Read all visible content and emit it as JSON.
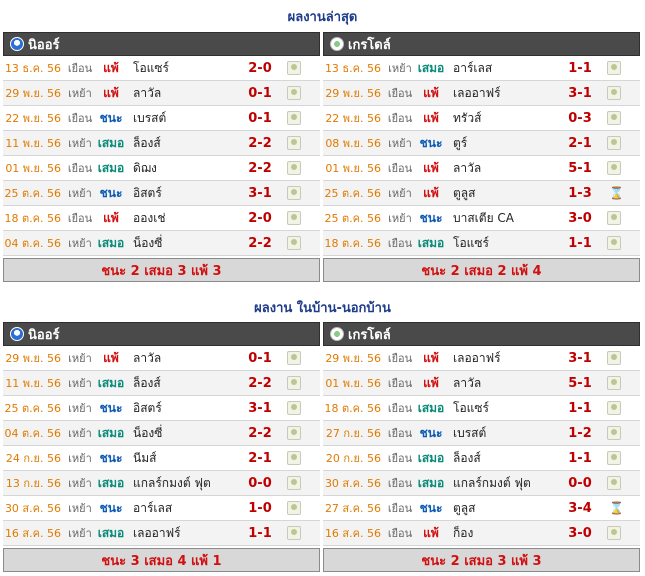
{
  "latest": {
    "title": "ผลงานล่าสุด",
    "left": {
      "team": "นิออร์",
      "rows": [
        {
          "date": "13 ธ.ค. 56",
          "venue": "เยือน",
          "result": "แพ้",
          "opp": "โอแซร์",
          "score": "2-0",
          "icon": "ball"
        },
        {
          "date": "29 พ.ย. 56",
          "venue": "เหย้า",
          "result": "แพ้",
          "opp": "ลาวัล",
          "score": "0-1",
          "icon": "ball"
        },
        {
          "date": "22 พ.ย. 56",
          "venue": "เยือน",
          "result": "ชนะ",
          "opp": "เบรสต์",
          "score": "0-1",
          "icon": "ball"
        },
        {
          "date": "11 พ.ย. 56",
          "venue": "เหย้า",
          "result": "เสมอ",
          "opp": "ล็องส์",
          "score": "2-2",
          "icon": "ball"
        },
        {
          "date": "01 พ.ย. 56",
          "venue": "เยือน",
          "result": "เสมอ",
          "opp": "ดิฌง",
          "score": "2-2",
          "icon": "ball"
        },
        {
          "date": "25 ต.ค. 56",
          "venue": "เหย้า",
          "result": "ชนะ",
          "opp": "อิสตร์",
          "score": "3-1",
          "icon": "ball"
        },
        {
          "date": "18 ต.ค. 56",
          "venue": "เยือน",
          "result": "แพ้",
          "opp": "อองเช่",
          "score": "2-0",
          "icon": "ball"
        },
        {
          "date": "04 ต.ค. 56",
          "venue": "เหย้า",
          "result": "เสมอ",
          "opp": "น็องซี่",
          "score": "2-2",
          "icon": "ball"
        }
      ],
      "summary": "ชนะ 2 เสมอ 3 แพ้ 3"
    },
    "right": {
      "team": "เกรโดล์",
      "rows": [
        {
          "date": "13 ธ.ค. 56",
          "venue": "เหย้า",
          "result": "เสมอ",
          "opp": "อาร์เลส",
          "score": "1-1",
          "icon": "ball"
        },
        {
          "date": "29 พ.ย. 56",
          "venue": "เยือน",
          "result": "แพ้",
          "opp": "เลออาฟร์",
          "score": "3-1",
          "icon": "ball"
        },
        {
          "date": "22 พ.ย. 56",
          "venue": "เยือน",
          "result": "แพ้",
          "opp": "ทรัวส์",
          "score": "0-3",
          "icon": "ball"
        },
        {
          "date": "08 พ.ย. 56",
          "venue": "เหย้า",
          "result": "ชนะ",
          "opp": "ตูร์",
          "score": "2-1",
          "icon": "ball"
        },
        {
          "date": "01 พ.ย. 56",
          "venue": "เยือน",
          "result": "แพ้",
          "opp": "ลาวัล",
          "score": "5-1",
          "icon": "ball"
        },
        {
          "date": "25 ต.ค. 56",
          "venue": "เหย้า",
          "result": "แพ้",
          "opp": "ตูลูส",
          "score": "1-3",
          "icon": "hourglass"
        },
        {
          "date": "25 ต.ค. 56",
          "venue": "เหย้า",
          "result": "ชนะ",
          "opp": "บาสเตีย CA",
          "score": "3-0",
          "icon": "ball"
        },
        {
          "date": "18 ต.ค. 56",
          "venue": "เยือน",
          "result": "เสมอ",
          "opp": "โอแซร์",
          "score": "1-1",
          "icon": "ball"
        }
      ],
      "summary": "ชนะ 2 เสมอ 2 แพ้ 4"
    }
  },
  "homeaway": {
    "title": "ผลงาน ในบ้าน-นอกบ้าน",
    "left": {
      "team": "นิออร์",
      "rows": [
        {
          "date": "29 พ.ย. 56",
          "venue": "เหย้า",
          "result": "แพ้",
          "opp": "ลาวัล",
          "score": "0-1",
          "icon": "ball"
        },
        {
          "date": "11 พ.ย. 56",
          "venue": "เหย้า",
          "result": "เสมอ",
          "opp": "ล็องส์",
          "score": "2-2",
          "icon": "ball"
        },
        {
          "date": "25 ต.ค. 56",
          "venue": "เหย้า",
          "result": "ชนะ",
          "opp": "อิสตร์",
          "score": "3-1",
          "icon": "ball"
        },
        {
          "date": "04 ต.ค. 56",
          "venue": "เหย้า",
          "result": "เสมอ",
          "opp": "น็องซี่",
          "score": "2-2",
          "icon": "ball"
        },
        {
          "date": "24 ก.ย. 56",
          "venue": "เหย้า",
          "result": "ชนะ",
          "opp": "นีมส์",
          "score": "2-1",
          "icon": "ball"
        },
        {
          "date": "13 ก.ย. 56",
          "venue": "เหย้า",
          "result": "เสมอ",
          "opp": "แกลร์กมงต์ ฟุต",
          "score": "0-0",
          "icon": "ball"
        },
        {
          "date": "30 ส.ค. 56",
          "venue": "เหย้า",
          "result": "ชนะ",
          "opp": "อาร์เลส",
          "score": "1-0",
          "icon": "ball"
        },
        {
          "date": "16 ส.ค. 56",
          "venue": "เหย้า",
          "result": "เสมอ",
          "opp": "เลออาฟร์",
          "score": "1-1",
          "icon": "ball"
        }
      ],
      "summary": "ชนะ 3 เสมอ 4 แพ้ 1"
    },
    "right": {
      "team": "เกรโดล์",
      "rows": [
        {
          "date": "29 พ.ย. 56",
          "venue": "เยือน",
          "result": "แพ้",
          "opp": "เลออาฟร์",
          "score": "3-1",
          "icon": "ball"
        },
        {
          "date": "01 พ.ย. 56",
          "venue": "เยือน",
          "result": "แพ้",
          "opp": "ลาวัล",
          "score": "5-1",
          "icon": "ball"
        },
        {
          "date": "18 ต.ค. 56",
          "venue": "เยือน",
          "result": "เสมอ",
          "opp": "โอแซร์",
          "score": "1-1",
          "icon": "ball"
        },
        {
          "date": "27 ก.ย. 56",
          "venue": "เยือน",
          "result": "ชนะ",
          "opp": "เบรสต์",
          "score": "1-2",
          "icon": "ball"
        },
        {
          "date": "20 ก.ย. 56",
          "venue": "เยือน",
          "result": "เสมอ",
          "opp": "ล็องส์",
          "score": "1-1",
          "icon": "ball"
        },
        {
          "date": "30 ส.ค. 56",
          "venue": "เยือน",
          "result": "เสมอ",
          "opp": "แกลร์กมงต์ ฟุต",
          "score": "0-0",
          "icon": "ball"
        },
        {
          "date": "27 ส.ค. 56",
          "venue": "เยือน",
          "result": "ชนะ",
          "opp": "ตูลูส",
          "score": "3-4",
          "icon": "hourglass"
        },
        {
          "date": "16 ส.ค. 56",
          "venue": "เยือน",
          "result": "แพ้",
          "opp": "ก็อง",
          "score": "3-0",
          "icon": "ball"
        }
      ],
      "summary": "ชนะ 2 เสมอ 3 แพ้ 3"
    }
  }
}
